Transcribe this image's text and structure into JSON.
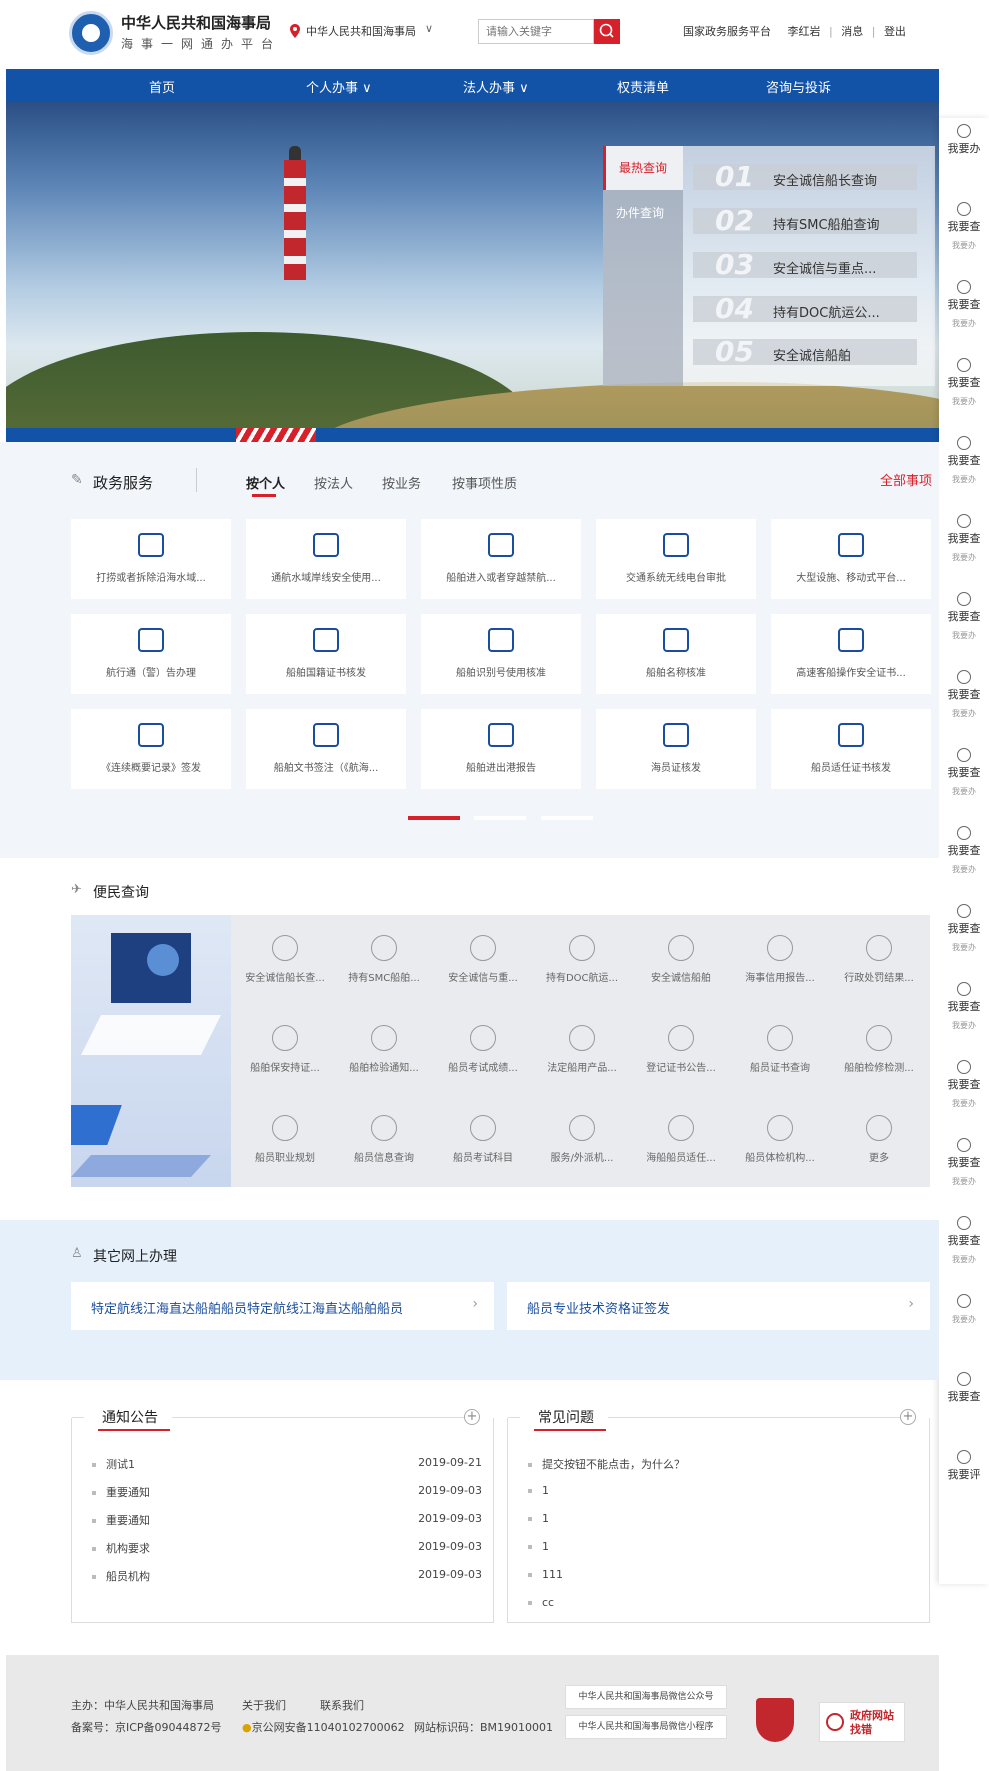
{
  "header": {
    "org_name": "中华人民共和国海事局",
    "platform_name": "海事一网通办平台",
    "location": "中华人民共和国海事局",
    "search_placeholder": "请输入关键字",
    "links": [
      "国家政务服务平台",
      "李红岩",
      "消息",
      "登出"
    ]
  },
  "nav": [
    "首页",
    "个人办事",
    "法人办事",
    "权责清单",
    "咨询与投诉"
  ],
  "nav_chevron": "∨",
  "banner": {
    "tabs": [
      "最热查询",
      "办件查询"
    ],
    "items": [
      {
        "num": "01",
        "label": "安全诚信船长查询"
      },
      {
        "num": "02",
        "label": "持有SMC船舶查询"
      },
      {
        "num": "03",
        "label": "安全诚信与重点..."
      },
      {
        "num": "04",
        "label": "持有DOC航运公..."
      },
      {
        "num": "05",
        "label": "安全诚信船舶"
      }
    ]
  },
  "right_sidebar": [
    {
      "label": "我要办",
      "sub": ""
    },
    {
      "label": "我要查",
      "sub": "我要办"
    },
    {
      "label": "我要查",
      "sub": "我要办"
    },
    {
      "label": "我要查",
      "sub": "我要办"
    },
    {
      "label": "我要查",
      "sub": "我要办"
    },
    {
      "label": "我要查",
      "sub": "我要办"
    },
    {
      "label": "我要查",
      "sub": "我要办"
    },
    {
      "label": "我要查",
      "sub": "我要办"
    },
    {
      "label": "我要查",
      "sub": "我要办"
    },
    {
      "label": "我要查",
      "sub": "我要办"
    },
    {
      "label": "我要查",
      "sub": "我要办"
    },
    {
      "label": "我要查",
      "sub": "我要办"
    },
    {
      "label": "我要查",
      "sub": "我要办"
    },
    {
      "label": "我要查",
      "sub": "我要办"
    },
    {
      "label": "我要查",
      "sub": "我要办"
    },
    {
      "label": "",
      "sub": "我要办"
    },
    {
      "label": "我要查",
      "sub": ""
    },
    {
      "label": "我要评",
      "sub": ""
    }
  ],
  "services": {
    "title": "政务服务",
    "tabs": [
      "按个人",
      "按法人",
      "按业务",
      "按事项性质"
    ],
    "all_label": "全部事项",
    "cards": [
      "打捞或者拆除沿海水域...",
      "通航水域岸线安全使用...",
      "船舶进入或者穿越禁航...",
      "交通系统无线电台审批",
      "大型设施、移动式平台...",
      "航行通（警）告办理",
      "船舶国籍证书核发",
      "船舶识别号使用核准",
      "船舶名称核准",
      "高速客船操作安全证书...",
      "《连续概要记录》签发",
      "船舶文书签注（《航海...",
      "船舶进出港报告",
      "海员证核发",
      "船员适任证书核发"
    ]
  },
  "query": {
    "title": "便民查询",
    "cells": [
      "安全诚信船长查...",
      "持有SMC船舶...",
      "安全诚信与重...",
      "持有DOC航运...",
      "安全诚信船舶",
      "海事信用报告...",
      "行政处罚结果...",
      "船舶保安持证...",
      "船舶检验通知...",
      "船员考试成绩...",
      "法定船用产品...",
      "登记证书公告...",
      "船员证书查询",
      "船舶检修检测...",
      "船员职业规划",
      "船员信息查询",
      "船员考试科目",
      "服务/外派机...",
      "海船船员适任...",
      "船员体检机构...",
      "更多"
    ]
  },
  "other": {
    "title": "其它网上办理",
    "cards": [
      "特定航线江海直达船舶船员特定航线江海直达船舶船员",
      "船员专业技术资格证签发"
    ]
  },
  "notices": {
    "title": "通知公告",
    "items": [
      {
        "title": "测试1",
        "date": "2019-09-21"
      },
      {
        "title": "重要通知",
        "date": "2019-09-03"
      },
      {
        "title": "重要通知",
        "date": "2019-09-03"
      },
      {
        "title": "机构要求",
        "date": "2019-09-03"
      },
      {
        "title": "船员机构",
        "date": "2019-09-03"
      }
    ]
  },
  "faq": {
    "title": "常见问题",
    "items": [
      "提交按钮不能点击，为什么？",
      "1",
      "1",
      "1",
      "111",
      "cc"
    ]
  },
  "footer": {
    "sponsor": "主办：中华人民共和国海事局",
    "about": "关于我们",
    "contact": "联系我们",
    "icp": "备案号：京ICP备09044872号",
    "police": "京公网安备11040102700062",
    "site_id": "网站标识码：BM19010001",
    "wechat": "中华人民共和国海事局微信公众号",
    "mini": "中华人民共和国海事局微信小程序",
    "gov_label": "政府网站 找错"
  }
}
